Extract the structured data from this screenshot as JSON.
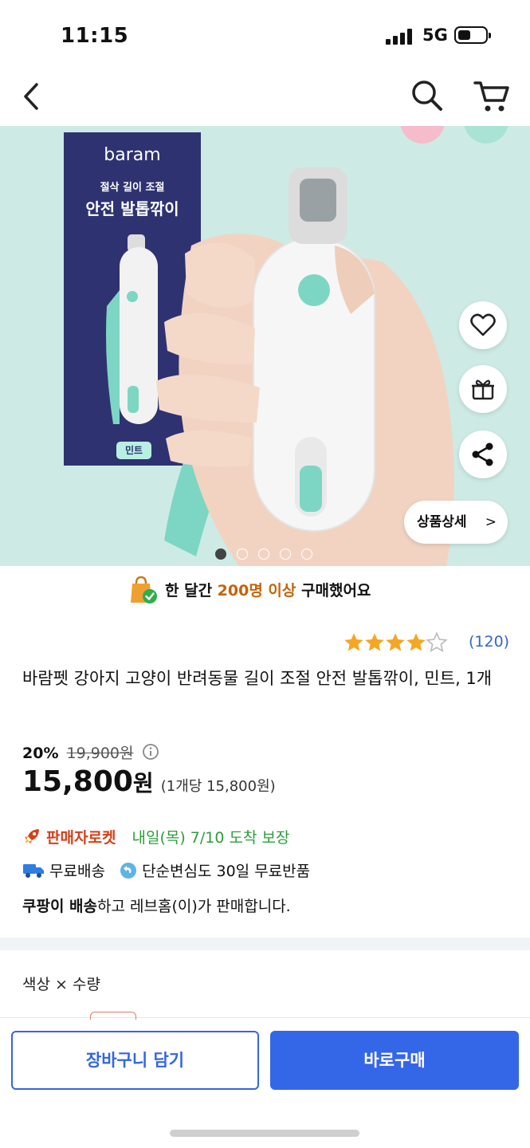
{
  "status_bar": {
    "time": "11:15",
    "network": "5G"
  },
  "nav": {
    "back_icon": "chevron-left-icon",
    "search_icon": "search-icon",
    "cart_icon": "cart-icon"
  },
  "hero": {
    "box_brand": "baram",
    "box_subtitle": "절삭 길이 조절",
    "box_title": "안전 발톱깎이",
    "box_tag": "민트",
    "detail_button": "상품상세",
    "detail_chevron": ">",
    "pager": {
      "count": 5,
      "active": 1
    },
    "side_buttons": [
      "heart-icon",
      "gift-icon",
      "share-icon"
    ],
    "colors": {
      "background": "#cdebe4",
      "box": "#2e3270",
      "mint": "#7dd6c3"
    }
  },
  "social_proof": {
    "prefix": "한 달간 ",
    "highlight": "200명 이상",
    "suffix": " 구매했어요"
  },
  "rating": {
    "stars": 4,
    "max": 5,
    "count": "(120)"
  },
  "product": {
    "title": "바람펫 강아지 고양이 반려동물 길이 조절 안전 발톱깎이, 민트, 1개",
    "discount": "20%",
    "original_price": "19,900원",
    "price": "15,800",
    "price_unit": "원",
    "unit_price": "(1개당 15,800원)"
  },
  "delivery": {
    "rocket_label": "판매자로켓",
    "arrival": "내일(목) 7/10 도착 보장",
    "free_shipping": "무료배송",
    "free_return": "단순변심도 30일 무료반품",
    "seller_bold": "쿠팡이 배송",
    "seller_rest": "하고 레브홈(이)가 판매합니다."
  },
  "options": {
    "label": "색상 × 수량"
  },
  "bottom_bar": {
    "cart_button": "장바구니 담기",
    "buy_button": "바로구매"
  }
}
